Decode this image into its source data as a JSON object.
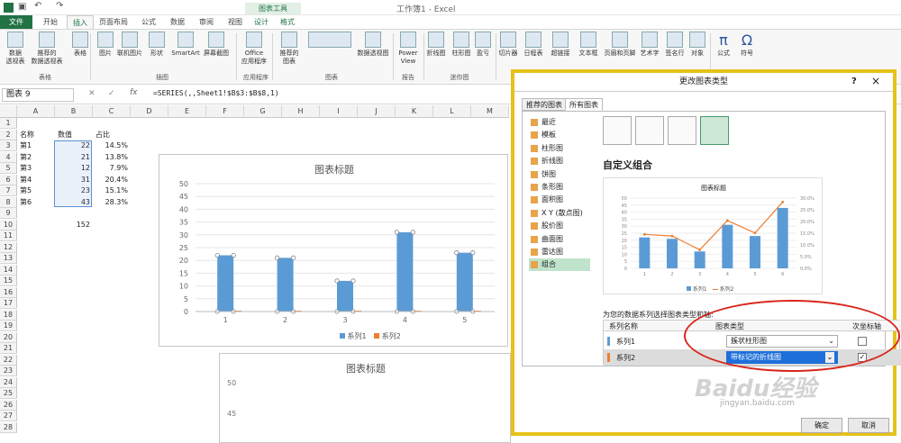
{
  "app": {
    "title": "工作簿1 - Excel",
    "tools": "图表工具"
  },
  "tabs": [
    "文件",
    "开始",
    "插入",
    "页面布局",
    "公式",
    "数据",
    "审阅",
    "视图",
    "设计",
    "格式"
  ],
  "ribbon": {
    "buttons": [
      "数据\n透视表",
      "推荐的\n数据透视表",
      "表格",
      "图片",
      "联机图片",
      "形状",
      "SmartArt",
      "屏幕截图",
      "Office\n应用程序",
      "推荐的\n图表",
      "数据透视图",
      "Power\nView",
      "折线图",
      "柱形图",
      "盈亏",
      "切片器",
      "日程表",
      "超链接",
      "文本框",
      "页眉和页脚",
      "艺术字",
      "签名行",
      "对象",
      "公式",
      "符号"
    ],
    "groups": [
      "表格",
      "插图",
      "应用程序",
      "图表",
      "报告",
      "迷你图"
    ]
  },
  "formula": {
    "namebox": "图表 9",
    "fx": "fx",
    "text": "=SERIES(,,Sheet1!$B$3:$B$8,1)"
  },
  "grid": {
    "cols": [
      "A",
      "B",
      "C",
      "D",
      "E",
      "F",
      "G",
      "H",
      "I",
      "J",
      "K",
      "L",
      "M"
    ],
    "rows": [
      "1",
      "2",
      "3",
      "4",
      "5",
      "6",
      "7",
      "8",
      "9",
      "10",
      "11",
      "12",
      "13",
      "14",
      "15",
      "16",
      "17",
      "18",
      "19",
      "20",
      "21",
      "22",
      "23",
      "24",
      "25",
      "26",
      "27",
      "28"
    ],
    "headers": [
      "名称",
      "数值",
      "占比"
    ],
    "data": [
      [
        "第1",
        "22",
        "14.5%"
      ],
      [
        "第2",
        "21",
        "13.8%"
      ],
      [
        "第3",
        "12",
        "7.9%"
      ],
      [
        "第4",
        "31",
        "20.4%"
      ],
      [
        "第5",
        "23",
        "15.1%"
      ],
      [
        "第6",
        "43",
        "28.3%"
      ]
    ],
    "total": "152"
  },
  "chart_data": [
    {
      "type": "bar",
      "title": "图表标题",
      "categories": [
        "1",
        "2",
        "3",
        "4",
        "5"
      ],
      "series": [
        {
          "name": "系列1",
          "values": [
            22,
            21,
            12,
            31,
            23
          ]
        },
        {
          "name": "系列2",
          "values": [
            0.145,
            0.138,
            0.079,
            0.204,
            0.151
          ]
        }
      ],
      "ylim": [
        0,
        50
      ],
      "yticks": [
        "0",
        "5",
        "10",
        "15",
        "20",
        "25",
        "30",
        "35",
        "40",
        "45",
        "50"
      ]
    },
    {
      "type": "bar",
      "title": "图表标题",
      "yticks": [
        "50",
        "45",
        "40"
      ]
    }
  ],
  "dialog": {
    "title": "更改图表类型",
    "help": "?",
    "close": "×",
    "tabs": [
      "推荐的图表",
      "所有图表"
    ],
    "types": [
      "最近",
      "模板",
      "柱形图",
      "折线图",
      "饼图",
      "条形图",
      "面积图",
      "X Y (散点图)",
      "股价图",
      "曲面图",
      "雷达图",
      "组合"
    ],
    "heading": "自定义组合",
    "preview_title": "图表标题",
    "preview_left_ticks": [
      "50",
      "45",
      "40",
      "35",
      "30",
      "25",
      "20",
      "15",
      "10",
      "5",
      "0"
    ],
    "preview_right_ticks": [
      "30.0%",
      "25.0%",
      "20.0%",
      "15.0%",
      "10.0%",
      "5.0%",
      "0.0%"
    ],
    "preview_legend": [
      "系列1",
      "系列2"
    ],
    "prompt": "为您的数据系列选择图表类型和轴:",
    "table_headers": [
      "系列名称",
      "图表类型",
      "次坐标轴"
    ],
    "series_rows": [
      {
        "name": "系列1",
        "type": "簇状柱形图",
        "secondary": false,
        "color": "#5b9bd5"
      },
      {
        "name": "系列2",
        "type": "带标记的折线图",
        "secondary": true,
        "color": "#ed7d31"
      }
    ],
    "ok": "确定",
    "cancel": "取消"
  },
  "watermark": {
    "brand": "Baidu经验",
    "url": "jingyan.baidu.com"
  },
  "colors": {
    "excel_green": "#217346",
    "bar": "#5b9bd5",
    "line": "#ed7d31",
    "highlight": "#e6c21a"
  }
}
